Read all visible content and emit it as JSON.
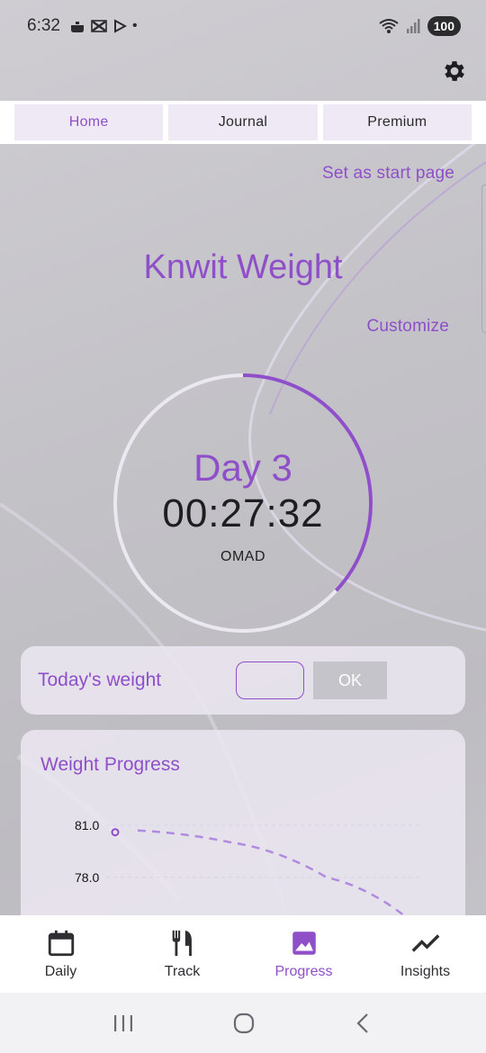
{
  "status_bar": {
    "time": "6:32",
    "dot": "•",
    "battery": "100"
  },
  "tabs": [
    {
      "label": "Home"
    },
    {
      "label": "Journal"
    },
    {
      "label": "Premium"
    }
  ],
  "links": {
    "start_page": "Set as start page",
    "customize": "Customize"
  },
  "app_title": "Knwit Weight",
  "fast": {
    "day": "Day 3",
    "timer": "00:27:32",
    "plan": "OMAD",
    "progress_fraction": 0.37
  },
  "weight_entry": {
    "label": "Today's weight",
    "value": "",
    "ok_label": "OK"
  },
  "chart_data": {
    "type": "line",
    "title": "Weight Progress",
    "y_ticks": [
      "81.0",
      "78.0"
    ],
    "ylim": [
      75,
      82
    ],
    "points": [
      {
        "x": 0,
        "y": 80.6
      }
    ],
    "trend": [
      {
        "x": 0.0,
        "y": 80.7
      },
      {
        "x": 0.3,
        "y": 80.0
      },
      {
        "x": 0.6,
        "y": 78.0
      },
      {
        "x": 0.9,
        "y": 75.0
      }
    ],
    "grid": true
  },
  "bottom_nav": [
    {
      "label": "Daily",
      "icon": "calendar-icon"
    },
    {
      "label": "Track",
      "icon": "fork-knife-icon"
    },
    {
      "label": "Progress",
      "icon": "image-icon"
    },
    {
      "label": "Insights",
      "icon": "trend-line-icon"
    }
  ],
  "colors": {
    "accent": "#8e4fc9",
    "card": "#ece8f2",
    "tab_bg": "#efe9f6"
  }
}
